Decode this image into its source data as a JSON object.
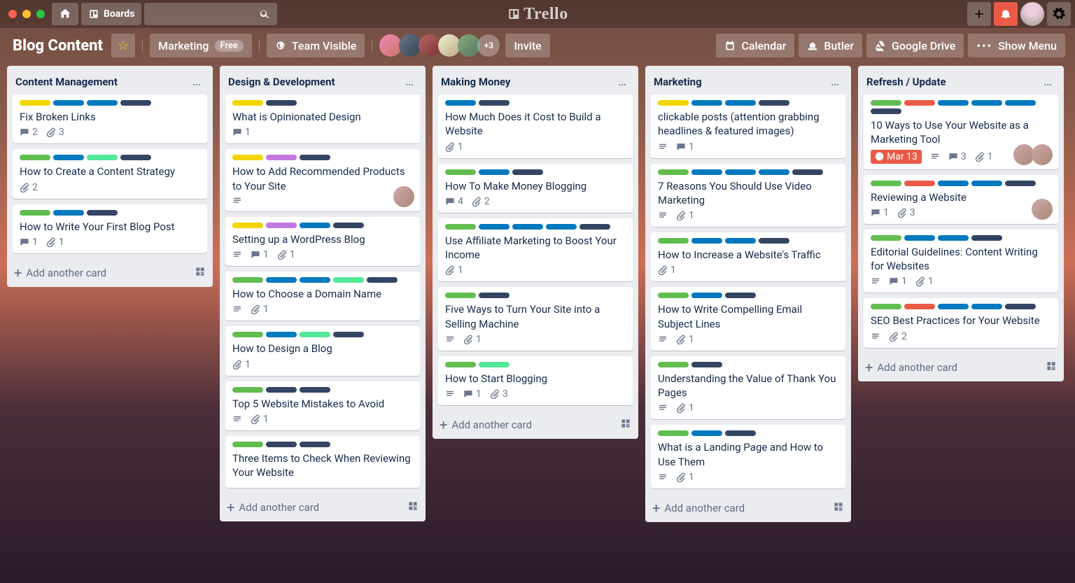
{
  "app": {
    "brand": "Trello",
    "boardsBtn": "Boards"
  },
  "header": {
    "title": "Blog Content",
    "team": "Marketing",
    "teamBadge": "Free",
    "visibility": "Team Visible",
    "extraMembers": "+3",
    "invite": "Invite",
    "calendar": "Calendar",
    "butler": "Butler",
    "gdrive": "Google Drive",
    "showMenu": "Show Menu"
  },
  "ui": {
    "addCard": "Add another card"
  },
  "labelColors": {
    "green": "#61bd4f",
    "yellow": "#f2d600",
    "blue": "#0079bf",
    "dark": "#344563",
    "teal": "#51e898",
    "purple": "#c377e0",
    "red": "#eb5a46"
  },
  "lists": [
    {
      "title": "Content Management",
      "cards": [
        {
          "labels": [
            "y",
            "b",
            "b",
            "d"
          ],
          "title": "Fix Broken Links",
          "badges": {
            "comments": "2",
            "attach": "3"
          }
        },
        {
          "labels": [
            "g",
            "b",
            "t",
            "d"
          ],
          "title": "How to Create a Content Strategy",
          "badges": {
            "attach": "2"
          }
        },
        {
          "labels": [
            "g",
            "b",
            "d"
          ],
          "title": "How to Write Your First Blog Post",
          "badges": {
            "comments": "1",
            "attach": "1"
          }
        }
      ]
    },
    {
      "title": "Design & Development",
      "cards": [
        {
          "labels": [
            "y",
            "d"
          ],
          "title": "What is Opinionated Design",
          "badges": {
            "comments": "1"
          }
        },
        {
          "labels": [
            "y",
            "p",
            "d"
          ],
          "title": "How to Add Recommended Products to Your Site",
          "badges": {
            "desc": true
          },
          "members": 1
        },
        {
          "labels": [
            "y",
            "p",
            "b",
            "d"
          ],
          "title": "Setting up a WordPress Blog",
          "badges": {
            "desc": true,
            "comments": "1",
            "attach": "1"
          }
        },
        {
          "labels": [
            "g",
            "b",
            "b",
            "t",
            "d"
          ],
          "title": "How to Choose a Domain Name",
          "badges": {
            "desc": true,
            "attach": "1"
          }
        },
        {
          "labels": [
            "g",
            "b",
            "t",
            "d"
          ],
          "title": "How to Design a Blog",
          "badges": {
            "attach": "1"
          }
        },
        {
          "labels": [
            "g",
            "d",
            "d"
          ],
          "title": "Top 5 Website Mistakes to Avoid",
          "badges": {
            "desc": true,
            "attach": "1"
          }
        },
        {
          "labels": [
            "g",
            "d",
            "d"
          ],
          "title": "Three Items to Check When Reviewing Your Website",
          "badges": {}
        }
      ]
    },
    {
      "title": "Making Money",
      "cards": [
        {
          "labels": [
            "b",
            "d"
          ],
          "title": "How Much Does it Cost to Build a Website",
          "badges": {
            "attach": "1"
          }
        },
        {
          "labels": [
            "g",
            "b",
            "d"
          ],
          "title": "How To Make Money Blogging",
          "badges": {
            "comments": "4",
            "attach": "2"
          }
        },
        {
          "labels": [
            "g",
            "b",
            "b",
            "b",
            "d"
          ],
          "title": "Use Affiliate Marketing to Boost Your Income",
          "badges": {
            "attach": "1"
          }
        },
        {
          "labels": [
            "g",
            "d"
          ],
          "title": "Five Ways to Turn Your Site into a Selling Machine",
          "badges": {
            "desc": true,
            "attach": "1"
          }
        },
        {
          "labels": [
            "g",
            "t"
          ],
          "title": "How to Start Blogging",
          "badges": {
            "desc": true,
            "comments": "1",
            "attach": "3"
          }
        }
      ]
    },
    {
      "title": "Marketing",
      "cards": [
        {
          "labels": [
            "y",
            "b",
            "b",
            "d"
          ],
          "title": "clickable posts (attention grabbing headlines & featured images)",
          "badges": {
            "desc": true,
            "comments": "1"
          }
        },
        {
          "labels": [
            "g",
            "b",
            "b",
            "b",
            "d"
          ],
          "title": "7 Reasons You Should Use Video Marketing",
          "badges": {
            "desc": true,
            "attach": "1"
          }
        },
        {
          "labels": [
            "g",
            "b",
            "b",
            "d"
          ],
          "title": "How to Increase a Website's Traffic",
          "badges": {
            "attach": "1"
          }
        },
        {
          "labels": [
            "g",
            "b",
            "d"
          ],
          "title": "How to Write Compelling Email Subject Lines",
          "badges": {
            "desc": true,
            "attach": "1"
          }
        },
        {
          "labels": [
            "g",
            "d"
          ],
          "title": "Understanding the Value of Thank You Pages",
          "badges": {
            "desc": true,
            "attach": "1"
          }
        },
        {
          "labels": [
            "g",
            "b",
            "d"
          ],
          "title": "What is a Landing Page and How to Use Them",
          "badges": {
            "desc": true,
            "attach": "1"
          }
        }
      ]
    },
    {
      "title": "Refresh / Update",
      "cards": [
        {
          "labels": [
            "g",
            "r",
            "b",
            "b",
            "b",
            "d"
          ],
          "title": "10 Ways to Use Your Website as a Marketing Tool",
          "badges": {
            "due": "Mar 13",
            "desc": true,
            "comments": "3",
            "attach": "1"
          },
          "members": 2
        },
        {
          "labels": [
            "g",
            "r",
            "b",
            "b",
            "d"
          ],
          "title": "Reviewing a Website",
          "badges": {
            "comments": "1",
            "attach": "3"
          },
          "members": 1
        },
        {
          "labels": [
            "g",
            "b",
            "b",
            "d"
          ],
          "title": "Editorial Guidelines: Content Writing for Websites",
          "badges": {
            "desc": true,
            "comments": "1",
            "attach": "1"
          }
        },
        {
          "labels": [
            "g",
            "r",
            "b",
            "b",
            "d"
          ],
          "title": "SEO Best Practices for Your Website",
          "badges": {
            "desc": true,
            "attach": "2"
          }
        }
      ]
    }
  ]
}
